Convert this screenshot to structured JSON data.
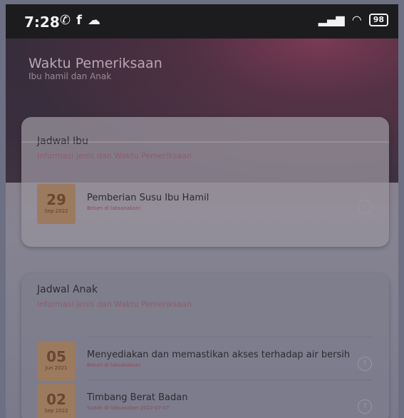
{
  "status_bar": {
    "time": "7:28",
    "left_icons": [
      "whatsapp-icon",
      "facebook-icon",
      "cloud-icon"
    ],
    "battery": "98"
  },
  "header": {
    "title": "Waktu Pemeriksaan",
    "subtitle": "Ibu hamil dan Anak"
  },
  "jadwal_ibu": {
    "title": "Jadwal Ibu",
    "subtitle": "Informasi jenis dan Waktu Pemeriksaan",
    "items": [
      {
        "day": "29",
        "month_year": "Sep 2022",
        "title": "Pemberian Susu Ibu Hamil",
        "status": "Belum di laksanakan!"
      }
    ]
  },
  "jadwal_anak": {
    "title": "Jadwal Anak",
    "subtitle": "Informasi jenis dan Waktu Pemeriksaan",
    "items": [
      {
        "day": "05",
        "month_year": "Jun 2021",
        "title": "Menyediakan dan memastikan akses terhadap air bersih",
        "status": "Belum di laksanakan!"
      },
      {
        "day": "02",
        "month_year": "Sep 2022",
        "title": "Timbang Berat Badan",
        "status": "Sudah di laksanakan 2022-07-07"
      }
    ]
  }
}
